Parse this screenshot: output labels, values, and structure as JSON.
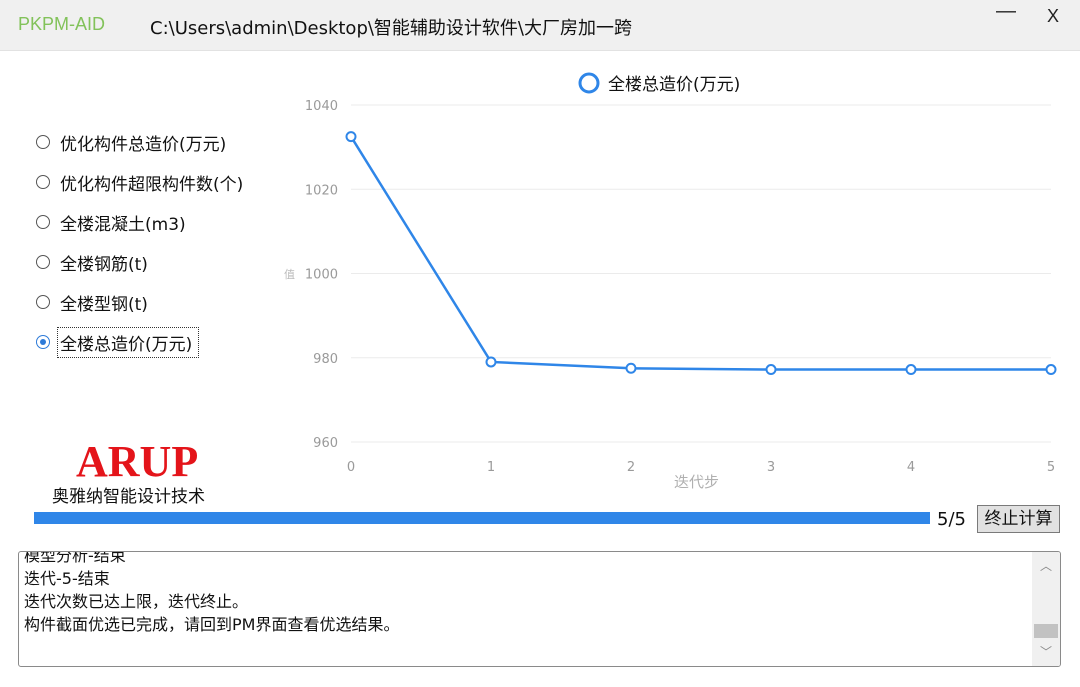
{
  "window": {
    "app_name": "PKPM-AID",
    "path": "C:\\Users\\admin\\Desktop\\智能辅助设计软件\\大厂房加一跨",
    "minimize_label": "—",
    "close_label": "X"
  },
  "options": [
    {
      "label": "优化构件总造价(万元)",
      "selected": false
    },
    {
      "label": "优化构件超限构件数(个)",
      "selected": false
    },
    {
      "label": "全楼混凝土(m3)",
      "selected": false
    },
    {
      "label": "全楼钢筋(t)",
      "selected": false
    },
    {
      "label": "全楼型钢(t)",
      "selected": false
    },
    {
      "label": "全楼总造价(万元)",
      "selected": true
    }
  ],
  "chart_data": {
    "type": "line",
    "legend": "全楼总造价(万元)",
    "xlabel": "迭代步",
    "ylabel": "值",
    "x": [
      0,
      1,
      2,
      3,
      4,
      5
    ],
    "series": [
      {
        "name": "全楼总造价(万元)",
        "values": [
          1032.5,
          979,
          977.5,
          977.2,
          977.2,
          977.2
        ]
      }
    ],
    "ylim": [
      960,
      1040
    ],
    "yticks": [
      960,
      980,
      1000,
      1020,
      1040
    ],
    "grid": true,
    "color": "#2f86e8"
  },
  "logo": {
    "main": "ARUP",
    "sub": "奥雅纳智能设计技术"
  },
  "progress": {
    "current": 5,
    "total": 5,
    "text": "5/5"
  },
  "stop_button_label": "终止计算",
  "log": {
    "lines": [
      "模型分析-结束",
      "迭代-5-结束",
      "迭代次数已达上限，迭代终止。",
      "构件截面优选已完成，请回到PM界面查看优选结果。"
    ],
    "scroll_up_icon": "chevron-up",
    "scroll_down_icon": "chevron-down"
  }
}
